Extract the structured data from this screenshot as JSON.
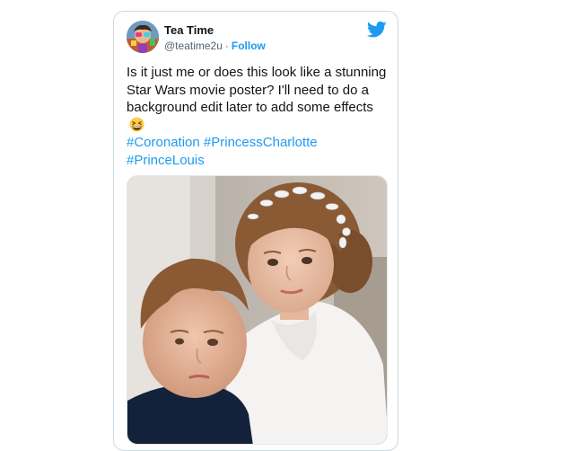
{
  "tweet": {
    "author": {
      "display_name": "Tea Time",
      "handle": "@teatime2u",
      "separator": "·",
      "follow_label": "Follow",
      "avatar_icon": "avatar-image"
    },
    "brand_icon": "twitter-bird-icon",
    "text": "Is it just me or does this look like a stunning Star Wars movie poster? I'll need to do a background edit later to add some effects",
    "emoji_icon": "grinning-squinting-face-emoji",
    "hashtags": [
      "#Coronation",
      "#PrincessCharlotte",
      "#PrinceLouis"
    ],
    "media": {
      "type": "photo",
      "description_icon": "photo-two-children"
    }
  },
  "colors": {
    "link_blue": "#1d9bf0",
    "text_primary": "#0f1419",
    "text_secondary": "#536471",
    "border": "#cfd9de"
  }
}
